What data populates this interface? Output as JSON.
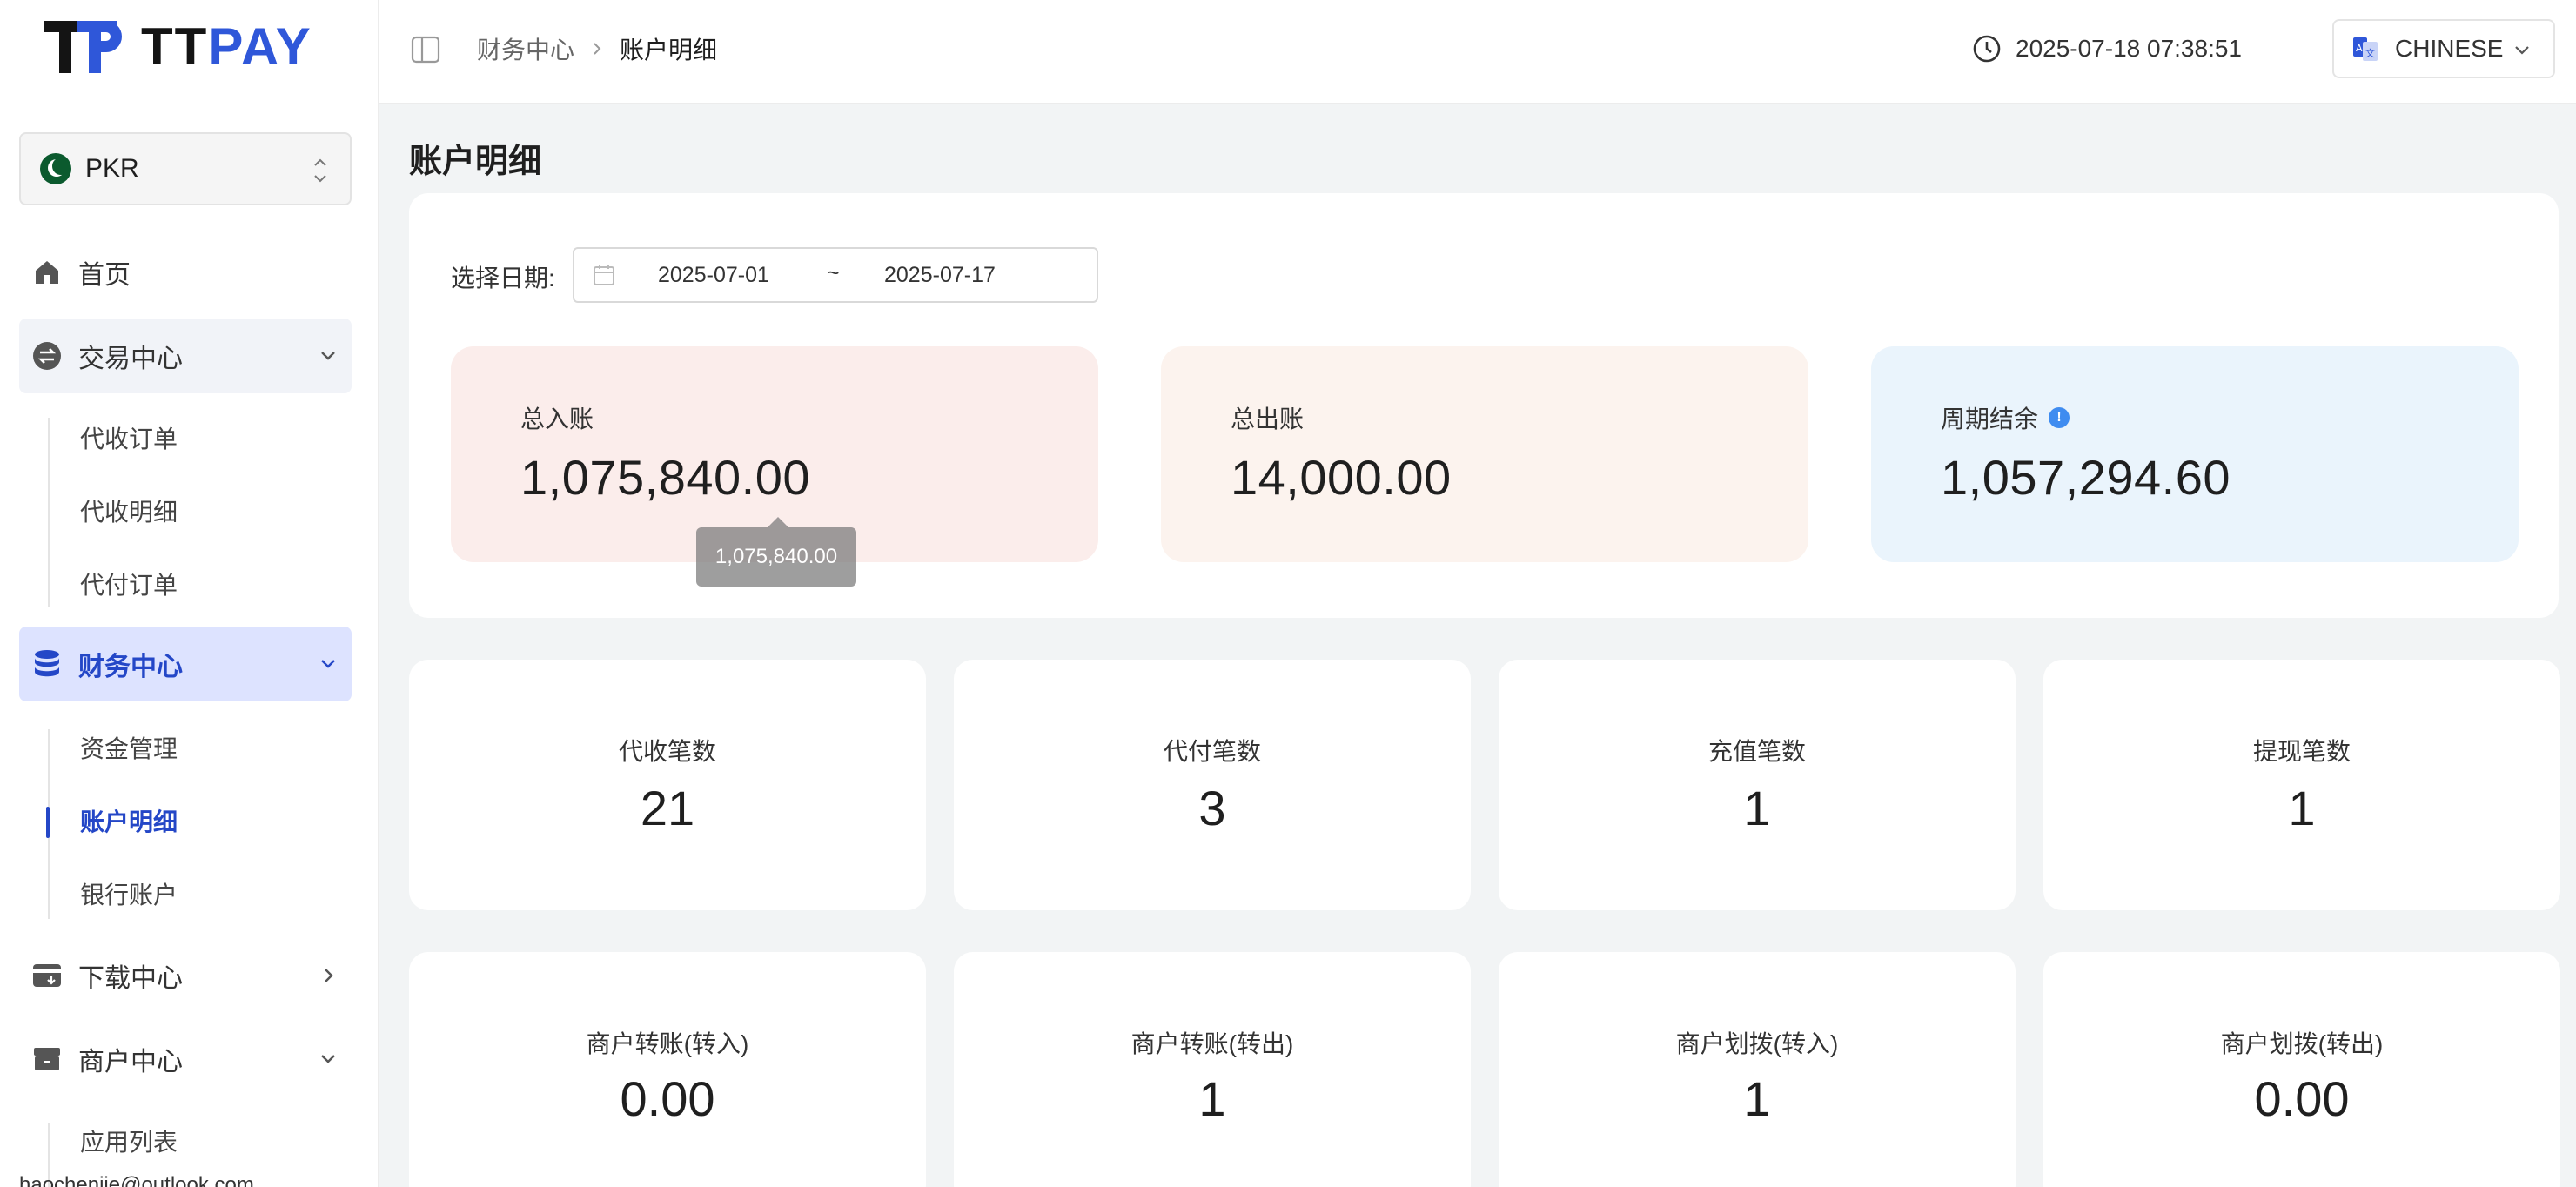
{
  "brand": {
    "name_a": "TT",
    "name_b": "PAY"
  },
  "currency": {
    "code": "PKR"
  },
  "sidebar": {
    "home": "首页",
    "trade": {
      "label": "交易中心",
      "items": [
        "代收订单",
        "代收明细",
        "代付订单"
      ]
    },
    "finance": {
      "label": "财务中心",
      "items": [
        "资金管理",
        "账户明细",
        "银行账户"
      ],
      "active_item": "账户明细"
    },
    "download": "下载中心",
    "merchant": {
      "label": "商户中心",
      "items": [
        "应用列表"
      ]
    },
    "email": "haochenjie@outlook.com"
  },
  "header": {
    "breadcrumb": [
      "财务中心",
      "账户明细"
    ],
    "datetime": "2025-07-18 07:38:51",
    "language": "CHINESE"
  },
  "page": {
    "title": "账户明细",
    "date_label": "选择日期:",
    "date_start": "2025-07-01",
    "date_sep": "~",
    "date_end": "2025-07-17"
  },
  "summary": [
    {
      "label": "总入账",
      "value": "1,075,840.00",
      "bg": "#fbedeb"
    },
    {
      "label": "总出账",
      "value": "14,000.00",
      "bg": "#fcf3ee"
    },
    {
      "label": "周期结余",
      "value": "1,057,294.60",
      "bg": "#eaf4fc"
    }
  ],
  "tooltip": "1,075,840.00",
  "stats_row1": [
    {
      "label": "代收笔数",
      "value": "21"
    },
    {
      "label": "代付笔数",
      "value": "3"
    },
    {
      "label": "充值笔数",
      "value": "1"
    },
    {
      "label": "提现笔数",
      "value": "1"
    }
  ],
  "stats_row2": [
    {
      "label": "商户转账(转入)",
      "value": "0.00"
    },
    {
      "label": "商户转账(转出)",
      "value": "1"
    },
    {
      "label": "商户划拨(转入)",
      "value": "1"
    },
    {
      "label": "商户划拨(转出)",
      "value": "0.00"
    }
  ],
  "colors": {
    "accent": "#2447c7",
    "brand_blue": "#2f57d9",
    "info": "#3f8cf0"
  }
}
